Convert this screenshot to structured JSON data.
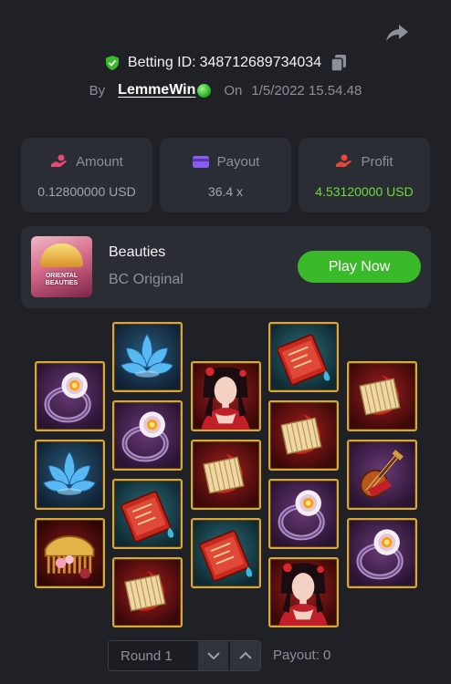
{
  "bet": {
    "label": "Betting ID:",
    "id": "348712689734034",
    "by_label": "By",
    "user": "LemmeWin",
    "on_label": "On",
    "date": "1/5/2022 15.54.48"
  },
  "stats": {
    "amount": {
      "label": "Amount",
      "value": "0.12800000 USD",
      "icon": "bet-hand-icon"
    },
    "payout": {
      "label": "Payout",
      "value": "36.4 x",
      "icon": "wallet-icon"
    },
    "profit": {
      "label": "Profit",
      "value": "4.53120000 USD",
      "icon": "coin-hand-icon"
    }
  },
  "game": {
    "name": "Beauties",
    "subtitle": "BC Original",
    "thumb_text": "ORIENTAL BEAUTIES",
    "play_label": "Play Now"
  },
  "reels": [
    [
      "ring",
      "lotus",
      "comb"
    ],
    [
      "lotus",
      "ring",
      "book",
      "fan"
    ],
    [
      "beauty",
      "fan",
      "book"
    ],
    [
      "book",
      "fan",
      "ring",
      "beauty"
    ],
    [
      "fan",
      "lute",
      "ring"
    ]
  ],
  "round": {
    "label": "Round 1",
    "payout_label": "Payout: 0"
  },
  "colors": {
    "background": "#1f2126",
    "card": "#2a2d33",
    "accent_green": "#3ab92b",
    "profit_green": "#6fdc3c",
    "tile_border": "#d8a83b"
  }
}
